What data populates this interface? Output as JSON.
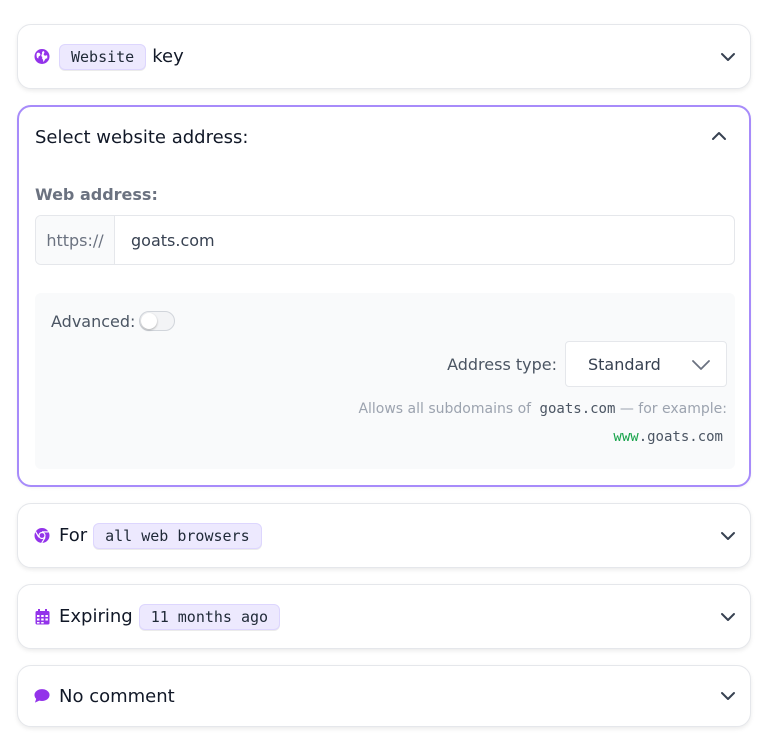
{
  "website_card": {
    "chip": "Website",
    "label": "key"
  },
  "address_card": {
    "title": "Select website address:",
    "field_label": "Web address:",
    "prefix": "https://",
    "value": "goats.com",
    "advanced_label": "Advanced:",
    "advanced_enabled": false,
    "address_type_label": "Address type:",
    "address_type_value": "Standard",
    "hint_text": "Allows all subdomains of",
    "hint_domain": "goats.com",
    "hint_suffix": "— for example:",
    "example_subdomain": "www",
    "example_rest": ".goats.com"
  },
  "browsers_card": {
    "prefix": "For",
    "chip": "all web browsers"
  },
  "expiry_card": {
    "prefix": "Expiring",
    "chip": "11 months ago"
  },
  "comment_card": {
    "label": "No comment"
  },
  "colors": {
    "accent": "#9333ea",
    "accent_border": "#a78bfa",
    "chip_bg": "#ede9fe",
    "example_green": "#16a34a"
  }
}
